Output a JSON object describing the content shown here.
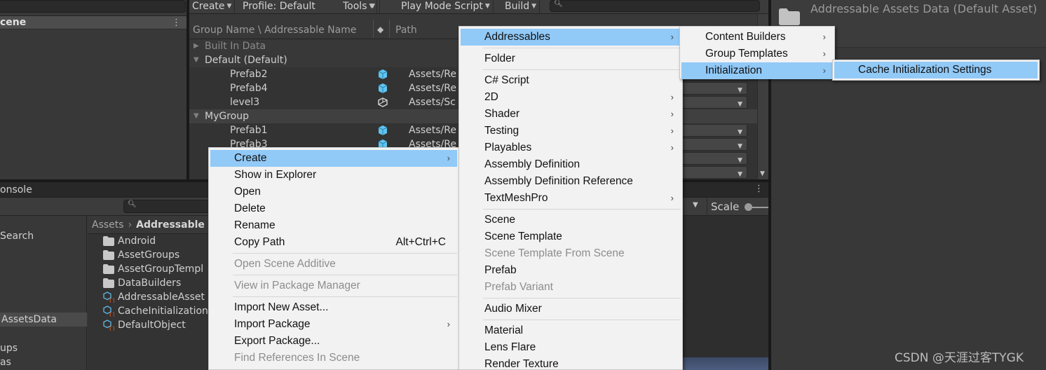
{
  "hierarchy": {
    "scene_label": "cene",
    "menu_icon": "kebab-icon"
  },
  "addressables_window": {
    "toolbar": {
      "create": "Create",
      "profile": "Profile: Default",
      "tools": "Tools",
      "play_mode_script": "Play Mode Script",
      "build": "Build",
      "search_placeholder": ""
    },
    "columns": {
      "name": "Group Name \\ Addressable Name",
      "path": "Path"
    },
    "rows": [
      {
        "type": "group",
        "name": "Built In Data",
        "expanded": false,
        "dim": true
      },
      {
        "type": "group",
        "name": "Default (Default)",
        "expanded": true
      },
      {
        "type": "entry",
        "name": "Prefab2",
        "icon": "prefab-cube-icon",
        "path": "Assets/Re"
      },
      {
        "type": "entry",
        "name": "Prefab4",
        "icon": "prefab-cube-icon",
        "path": "Assets/Re"
      },
      {
        "type": "entry",
        "name": "level3",
        "icon": "unity-scene-icon",
        "path": "Assets/Sc"
      },
      {
        "type": "group",
        "name": "MyGroup",
        "expanded": true
      },
      {
        "type": "entry",
        "name": "Prefab1",
        "icon": "prefab-cube-icon",
        "path": "Assets/Re"
      },
      {
        "type": "entry",
        "name": "Prefab3",
        "icon": "prefab-cube-icon",
        "path": "Assets/Re"
      }
    ]
  },
  "inspector": {
    "title": "Addressable Assets Data (Default Asset)",
    "icon": "folder-icon"
  },
  "project": {
    "tab_label": "onsole",
    "search_placeholder": "",
    "left_items": [
      {
        "label": "Search",
        "selected": false
      },
      {
        "label": "AssetsData",
        "selected": true
      },
      {
        "label": "ups",
        "selected": false
      },
      {
        "label": "as",
        "selected": false
      }
    ],
    "breadcrumb": {
      "root": "Assets",
      "current": "Addressable"
    },
    "files": [
      {
        "name": "Android",
        "icon": "folder-icon"
      },
      {
        "name": "AssetGroups",
        "icon": "folder-icon"
      },
      {
        "name": "AssetGroupTempl",
        "icon": "folder-icon"
      },
      {
        "name": "DataBuilders",
        "icon": "folder-icon"
      },
      {
        "name": "AddressableAsset",
        "icon": "scriptable-object-icon"
      },
      {
        "name": "CacheInitialization",
        "icon": "scriptable-object-icon"
      },
      {
        "name": "DefaultObject",
        "icon": "scriptable-object-icon"
      }
    ]
  },
  "scene_view": {
    "scale_label": "Scale"
  },
  "context_menu": {
    "items": [
      {
        "label": "Create",
        "submenu": true,
        "highlighted": true
      },
      {
        "label": "Show in Explorer"
      },
      {
        "label": "Open"
      },
      {
        "label": "Delete"
      },
      {
        "label": "Rename"
      },
      {
        "label": "Copy Path",
        "shortcut": "Alt+Ctrl+C"
      },
      {
        "separator": true
      },
      {
        "label": "Open Scene Additive",
        "disabled": true
      },
      {
        "separator": true
      },
      {
        "label": "View in Package Manager",
        "disabled": true
      },
      {
        "separator": true
      },
      {
        "label": "Import New Asset..."
      },
      {
        "label": "Import Package",
        "submenu": true
      },
      {
        "label": "Export Package..."
      },
      {
        "label": "Find References In Scene",
        "disabled": true
      }
    ]
  },
  "create_menu": {
    "items": [
      {
        "label": "Addressables",
        "submenu": true,
        "highlighted": true
      },
      {
        "separator": true
      },
      {
        "label": "Folder"
      },
      {
        "separator": true
      },
      {
        "label": "C# Script"
      },
      {
        "label": "2D",
        "submenu": true
      },
      {
        "label": "Shader",
        "submenu": true
      },
      {
        "label": "Testing",
        "submenu": true
      },
      {
        "label": "Playables",
        "submenu": true
      },
      {
        "label": "Assembly Definition"
      },
      {
        "label": "Assembly Definition Reference"
      },
      {
        "label": "TextMeshPro",
        "submenu": true
      },
      {
        "separator": true
      },
      {
        "label": "Scene"
      },
      {
        "label": "Scene Template"
      },
      {
        "label": "Scene Template From Scene",
        "disabled": true
      },
      {
        "label": "Prefab"
      },
      {
        "label": "Prefab Variant",
        "disabled": true
      },
      {
        "separator": true
      },
      {
        "label": "Audio Mixer"
      },
      {
        "separator": true
      },
      {
        "label": "Material"
      },
      {
        "label": "Lens Flare"
      },
      {
        "label": "Render Texture"
      }
    ]
  },
  "addressables_menu": {
    "items": [
      {
        "label": "Content Builders",
        "submenu": true
      },
      {
        "label": "Group Templates",
        "submenu": true
      },
      {
        "label": "Initialization",
        "submenu": true,
        "highlighted": true
      }
    ]
  },
  "initialization_menu": {
    "items": [
      {
        "label": "Cache Initialization Settings",
        "highlighted": true
      }
    ]
  },
  "watermark": "CSDN @天涯过客TYGK",
  "colors": {
    "menu_highlight": "#91c9f7",
    "menu_bg": "#f2f2f2",
    "editor_bg": "#383838",
    "prefab_icon": "#5fc4f0",
    "script_badge": "#e0551f"
  }
}
